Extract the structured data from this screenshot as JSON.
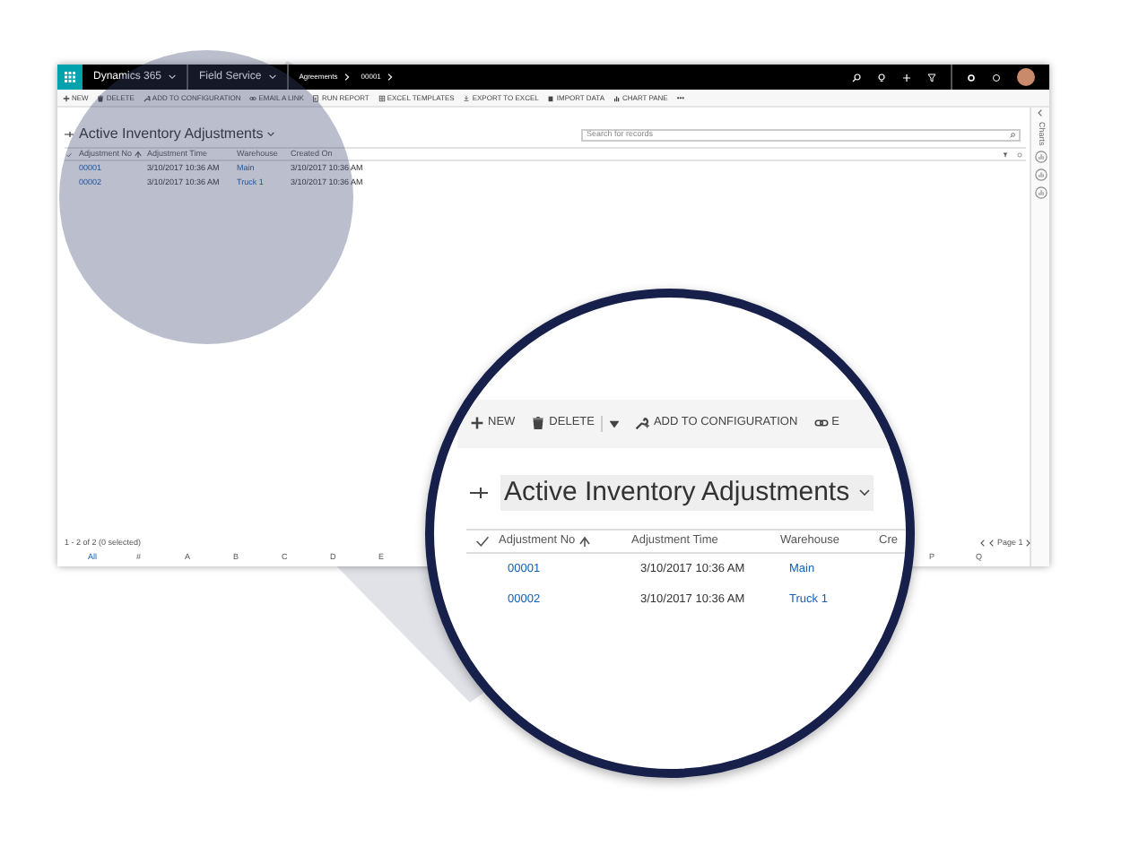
{
  "app": {
    "nav": {
      "app_name": "Dynamics 365",
      "area": "Field Service",
      "breadcrumb": [
        "Agreements",
        "00001"
      ]
    },
    "commands": [
      {
        "label": "NEW",
        "kind": "plus"
      },
      {
        "label": "DELETE",
        "kind": "trash"
      },
      {
        "label": "ADD TO CONFIGURATION",
        "kind": "wrench"
      },
      {
        "label": "EMAIL A LINK",
        "kind": "link"
      },
      {
        "label": "RUN REPORT",
        "kind": "report"
      },
      {
        "label": "EXCEL TEMPLATES",
        "kind": "excel"
      },
      {
        "label": "EXPORT TO EXCEL",
        "kind": "export"
      },
      {
        "label": "IMPORT DATA",
        "kind": "import"
      },
      {
        "label": "CHART PANE",
        "kind": "chart"
      },
      {
        "label": "•••",
        "kind": "more"
      }
    ],
    "view_title": "Active Inventory Adjustments",
    "search": {
      "placeholder": "Search for records"
    },
    "columns": [
      "Adjustment No",
      "Adjustment Time",
      "Warehouse",
      "Created On"
    ],
    "rows": [
      [
        "00001",
        "3/10/2017 10:36 AM",
        "Main",
        "3/10/2017 10:36 AM"
      ],
      [
        "00002",
        "3/10/2017 10:36 AM",
        "Truck 1",
        "3/10/2017 10:36 AM"
      ]
    ],
    "status": "1 - 2 of 2 (0 selected)",
    "letters_left": [
      "All",
      "#",
      "A",
      "B",
      "C",
      "D",
      "E"
    ],
    "letters_right": [
      "P",
      "Q"
    ],
    "pager": "Page 1",
    "side_pane": "Charts"
  },
  "magnifier": {
    "commands": [
      {
        "label": "NEW",
        "kind": "plus"
      },
      {
        "label": "DELETE",
        "kind": "trash"
      },
      {
        "label": "ADD TO CONFIGURATION",
        "kind": "wrench"
      },
      {
        "label": "E",
        "kind": "link"
      }
    ],
    "view_title": "Active Inventory Adjustments",
    "columns": [
      "Adjustment No",
      "Adjustment Time",
      "Warehouse",
      "Cre"
    ],
    "rows": [
      [
        "00001",
        "3/10/2017 10:36 AM",
        "Main"
      ],
      [
        "00002",
        "3/10/2017 10:36 AM",
        "Truck 1"
      ]
    ]
  }
}
